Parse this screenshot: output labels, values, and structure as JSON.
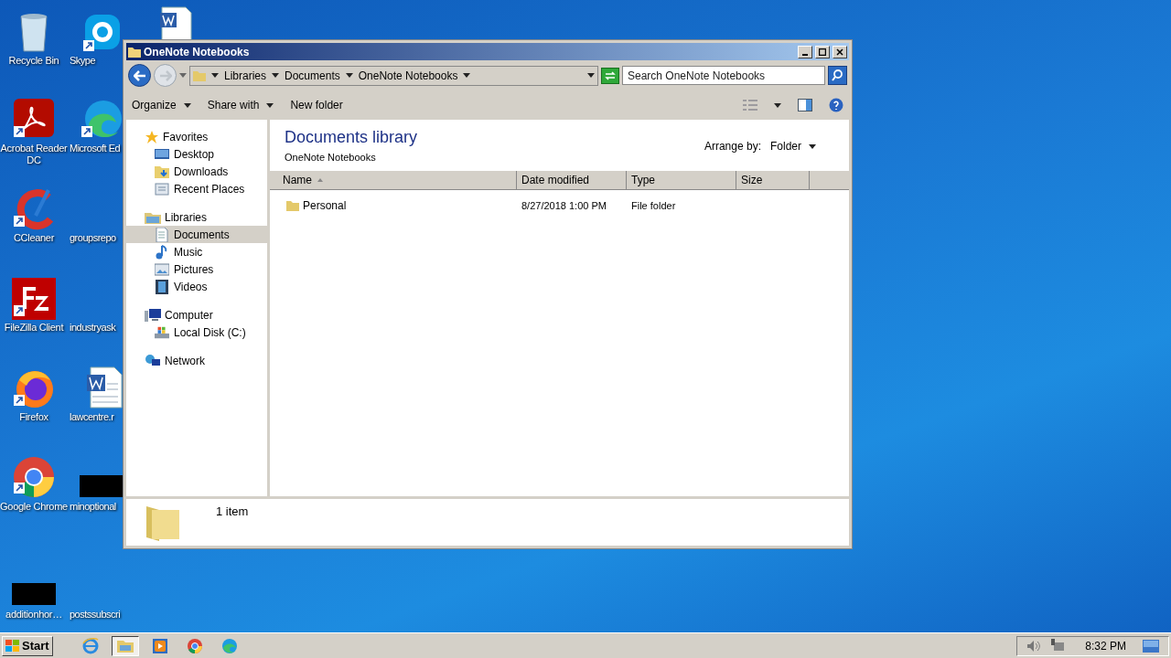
{
  "desktop_icons": [
    {
      "label": "Recycle Bin",
      "kind": "recycle"
    },
    {
      "label": "Skype",
      "kind": "skype"
    },
    {
      "kind": "word_partial"
    },
    {
      "label": "Acrobat Reader DC",
      "kind": "acrobat"
    },
    {
      "label": "Microsoft Ed",
      "kind": "edge"
    },
    {
      "label": "CCleaner",
      "kind": "ccleaner"
    },
    {
      "label": "groupsrepo",
      "kind": "blank"
    },
    {
      "label": "FileZilla Client",
      "kind": "filezilla"
    },
    {
      "label": "industryask",
      "kind": "blank"
    },
    {
      "label": "Firefox",
      "kind": "firefox"
    },
    {
      "label": "lawcentre.r",
      "kind": "word"
    },
    {
      "label": "Google Chrome",
      "kind": "chrome"
    },
    {
      "label": "minoptional",
      "kind": "redacted"
    },
    {
      "label": "additionhor…",
      "kind": "redacted"
    },
    {
      "label": "postssubscri",
      "kind": "blank"
    }
  ],
  "window": {
    "title": "OneNote Notebooks",
    "breadcrumb": [
      "Libraries",
      "Documents",
      "OneNote Notebooks"
    ],
    "search": {
      "placeholder": "Search OneNote Notebooks"
    },
    "toolbar": [
      {
        "label": "Organize",
        "has_menu": true
      },
      {
        "label": "Share with",
        "has_menu": true
      },
      {
        "label": "New folder",
        "has_menu": false
      }
    ],
    "nav": [
      {
        "label": "Favorites",
        "kind": "favorites",
        "selected": false,
        "children": [
          {
            "label": "Desktop",
            "kind": "desktop",
            "selected": false
          },
          {
            "label": "Downloads",
            "kind": "downloads",
            "selected": false
          },
          {
            "label": "Recent Places",
            "kind": "recent",
            "selected": false
          }
        ]
      },
      {
        "label": "Libraries",
        "kind": "libraries",
        "selected": false,
        "children": [
          {
            "label": "Documents",
            "kind": "documents",
            "selected": true
          },
          {
            "label": "Music",
            "kind": "music",
            "selected": false
          },
          {
            "label": "Pictures",
            "kind": "pictures",
            "selected": false
          },
          {
            "label": "Videos",
            "kind": "videos",
            "selected": false
          }
        ]
      },
      {
        "label": "Computer",
        "kind": "computer",
        "selected": false,
        "children": [
          {
            "label": "Local Disk (C:)",
            "kind": "disk",
            "selected": false
          }
        ]
      },
      {
        "label": "Network",
        "kind": "network",
        "selected": false
      }
    ],
    "library_title": "Documents library",
    "library_subtitle": "OneNote Notebooks",
    "arrange_label": "Arrange by:",
    "arrange_value": "Folder",
    "columns": [
      "Name",
      "Date modified",
      "Type",
      "Size"
    ],
    "rows": [
      {
        "name": "Personal",
        "date": "8/27/2018 1:00 PM",
        "type": "File folder"
      }
    ],
    "status": "1 item"
  },
  "taskbar": {
    "start": "Start",
    "apps": [
      {
        "kind": "ie",
        "selected": false
      },
      {
        "kind": "explorer",
        "selected": true
      },
      {
        "kind": "media",
        "selected": false
      },
      {
        "kind": "chrome",
        "selected": false
      },
      {
        "kind": "edge",
        "selected": false
      }
    ],
    "clock": "8:32 PM"
  }
}
